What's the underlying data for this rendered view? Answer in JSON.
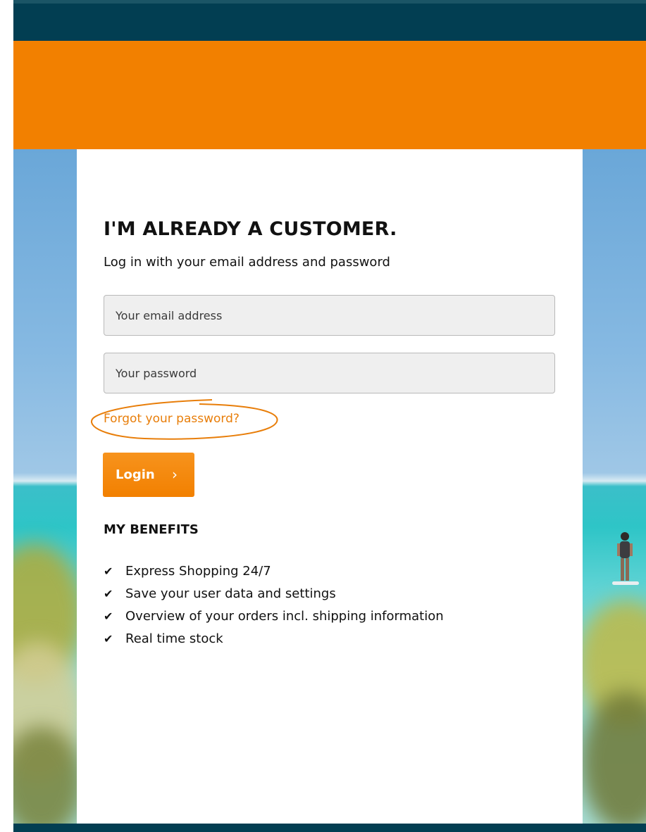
{
  "login": {
    "heading": "I'M ALREADY A CUSTOMER.",
    "subheading": "Log in with your email address and password",
    "email_placeholder": "Your email address",
    "password_placeholder": "Your password",
    "forgot_label": "Forgot your password?",
    "login_label": "Login",
    "login_chevron": "›"
  },
  "benefits": {
    "title": "MY BENEFITS",
    "check_icon": "✔",
    "items": [
      {
        "label": "Express Shopping 24/7"
      },
      {
        "label": "Save your user data and settings"
      },
      {
        "label": "Overview of your orders incl. shipping information"
      },
      {
        "label": "Real time stock"
      }
    ]
  },
  "colors": {
    "header_dark": "#023e52",
    "accent_orange": "#f28000",
    "link_orange": "#e87e0a"
  }
}
